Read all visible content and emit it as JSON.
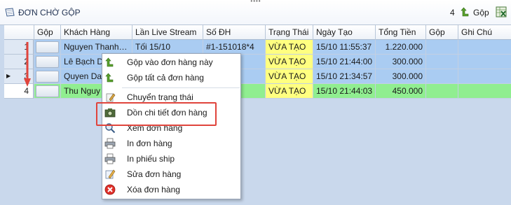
{
  "title": "ĐƠN CHỜ GỘP",
  "toolbar": {
    "count": "4",
    "gop_label": "Gộp"
  },
  "columns": [
    "Gộp",
    "Khách Hàng",
    "Lần Live Stream",
    "Số ĐH",
    "Trạng Thái",
    "Ngày Tạo",
    "Tổng Tiền",
    "Gộp",
    "Ghi Chú"
  ],
  "rows": [
    {
      "num": "1",
      "customer": "Nguyen Thanh…",
      "live": "Tối 15/10",
      "order": "#1-151018*4",
      "status": "VỪA TẠO",
      "date": "15/10 11:55:37",
      "total": "1.220.000"
    },
    {
      "num": "2",
      "customer": "Lê Bạch D",
      "live": "",
      "order": "8*3",
      "status": "VỪA TẠO",
      "date": "15/10 21:44:00",
      "total": "300.000"
    },
    {
      "num": "3",
      "customer": "Quyen Da",
      "live": "",
      "order": "8*6",
      "status": "VỪA TẠO",
      "date": "15/10 21:34:57",
      "total": "300.000"
    },
    {
      "num": "4",
      "customer": "Thu Nguy",
      "live": "",
      "order": "8*12",
      "status": "VỪA TẠO",
      "date": "15/10 21:44:03",
      "total": "450.000"
    }
  ],
  "menu": {
    "items": [
      {
        "label": "Gộp vào đơn  hàng này",
        "icon": "merge-arrow-icon"
      },
      {
        "label": "Gộp tất cả đơn hàng",
        "icon": "merge-arrow-icon"
      },
      {
        "label": "Chuyển trạng thái",
        "icon": "clipboard-pencil-icon"
      },
      {
        "label": "Dồn chi tiết đơn hàng",
        "icon": "camera-icon"
      },
      {
        "label": "Xem đơn hàng",
        "icon": "magnifier-icon"
      },
      {
        "label": "In đơn hàng",
        "icon": "printer-icon"
      },
      {
        "label": "In phiếu ship",
        "icon": "printer-icon"
      },
      {
        "label": "Sửa đơn hàng",
        "icon": "edit-icon"
      },
      {
        "label": "Xóa đơn hàng",
        "icon": "delete-icon"
      }
    ]
  },
  "colors": {
    "status_bg": "#ffff80",
    "selected_row": "#aaccf2",
    "green_row": "#90ee90",
    "highlight_border": "#e0443c"
  }
}
